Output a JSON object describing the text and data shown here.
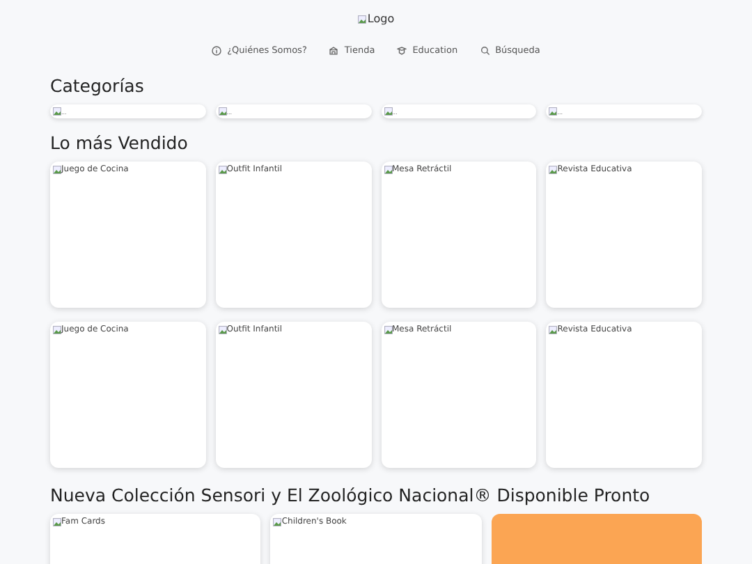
{
  "logo": {
    "alt": "Logo"
  },
  "nav": [
    {
      "label": "¿Quiénes Somos?",
      "kind": "info"
    },
    {
      "label": "Tienda",
      "kind": "store"
    },
    {
      "label": "Education",
      "kind": "education"
    },
    {
      "label": "Búsqueda",
      "kind": "search"
    }
  ],
  "categories": {
    "title": "Categorías",
    "items": [
      {
        "alt": "..."
      },
      {
        "alt": "..."
      },
      {
        "alt": "..."
      },
      {
        "alt": "..."
      }
    ]
  },
  "best_sellers": {
    "title": "Lo más Vendido",
    "rows": [
      [
        {
          "alt": "Juego de Cocina"
        },
        {
          "alt": "Outfit Infantil"
        },
        {
          "alt": "Mesa Retráctil"
        },
        {
          "alt": "Revista Educativa"
        }
      ],
      [
        {
          "alt": "Juego de Cocina"
        },
        {
          "alt": "Outfit Infantil"
        },
        {
          "alt": "Mesa Retráctil"
        },
        {
          "alt": "Revista Educativa"
        }
      ]
    ]
  },
  "new_collection": {
    "title": "Nueva Colección Sensori y El Zoológico Nacional® Disponible Pronto",
    "items": [
      {
        "kind": "image",
        "alt": "Fam Cards"
      },
      {
        "kind": "image",
        "alt": "Children's Book"
      },
      {
        "kind": "promo"
      }
    ]
  }
}
